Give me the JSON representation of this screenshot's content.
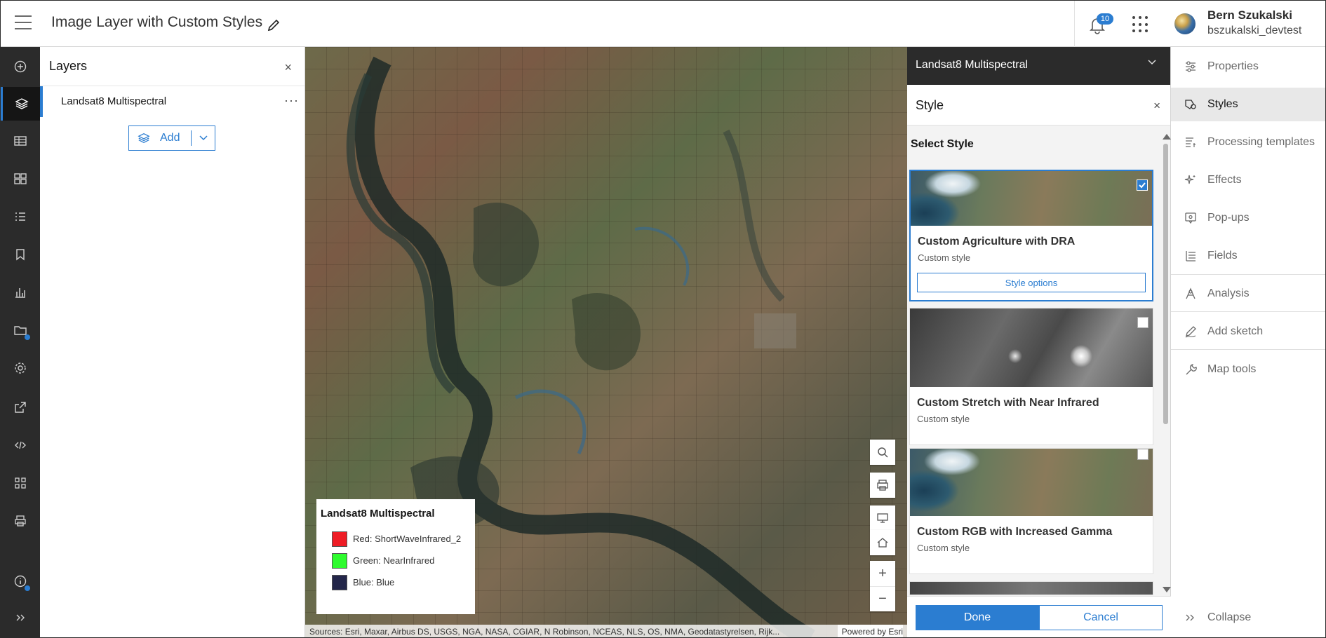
{
  "header": {
    "app_title": "Image Layer with Custom Styles",
    "notification_count": "10",
    "user_name": "Bern Szukalski",
    "user_id": "bszukalski_devtest"
  },
  "layers_panel": {
    "title": "Layers",
    "close": "×",
    "layer_name": "Landsat8 Multispectral",
    "more": "···",
    "add_label": "Add"
  },
  "map": {
    "legend": {
      "title": "Landsat8 Multispectral",
      "items": [
        {
          "label": "Red: ShortWaveInfrared_2",
          "color": "#ee1c25"
        },
        {
          "label": "Green: NearInfrared",
          "color": "#2efc2e"
        },
        {
          "label": "Blue: Blue",
          "color": "#23264a"
        }
      ]
    },
    "attribution": "Sources: Esri, Maxar, Airbus DS, USGS, NGA, NASA, CGIAR, N Robinson, NCEAS, NLS, OS, NMA, Geodatastyrelsen, Rijk...",
    "powered_by": "Powered by Esri",
    "zoom_in": "+",
    "zoom_out": "−"
  },
  "style_panel": {
    "layer_name": "Landsat8 Multispectral",
    "title": "Style",
    "close": "×",
    "subtitle": "Select Style",
    "cards": [
      {
        "title": "Custom Agriculture with DRA",
        "subtitle": "Custom style",
        "options_label": "Style options",
        "selected": true
      },
      {
        "title": "Custom Stretch with Near Infrared",
        "subtitle": "Custom style",
        "selected": false
      },
      {
        "title": "Custom RGB with Increased Gamma",
        "subtitle": "Custom style",
        "selected": false
      }
    ],
    "done_label": "Done",
    "cancel_label": "Cancel"
  },
  "right_nav": {
    "items": [
      {
        "label": "Properties",
        "icon": "sliders-icon"
      },
      {
        "label": "Styles",
        "icon": "styles-icon",
        "active": true
      },
      {
        "label": "Processing templates",
        "icon": "processing-icon"
      },
      {
        "label": "Effects",
        "icon": "effects-icon"
      },
      {
        "label": "Pop-ups",
        "icon": "popup-icon"
      },
      {
        "label": "Fields",
        "icon": "fields-icon"
      },
      {
        "label": "Analysis",
        "icon": "analysis-icon"
      },
      {
        "label": "Add sketch",
        "icon": "sketch-icon"
      },
      {
        "label": "Map tools",
        "icon": "wrench-icon"
      }
    ],
    "collapse_label": "Collapse"
  },
  "colors": {
    "accent": "#2b7dd1",
    "dark_nav": "#2b2b2b"
  }
}
